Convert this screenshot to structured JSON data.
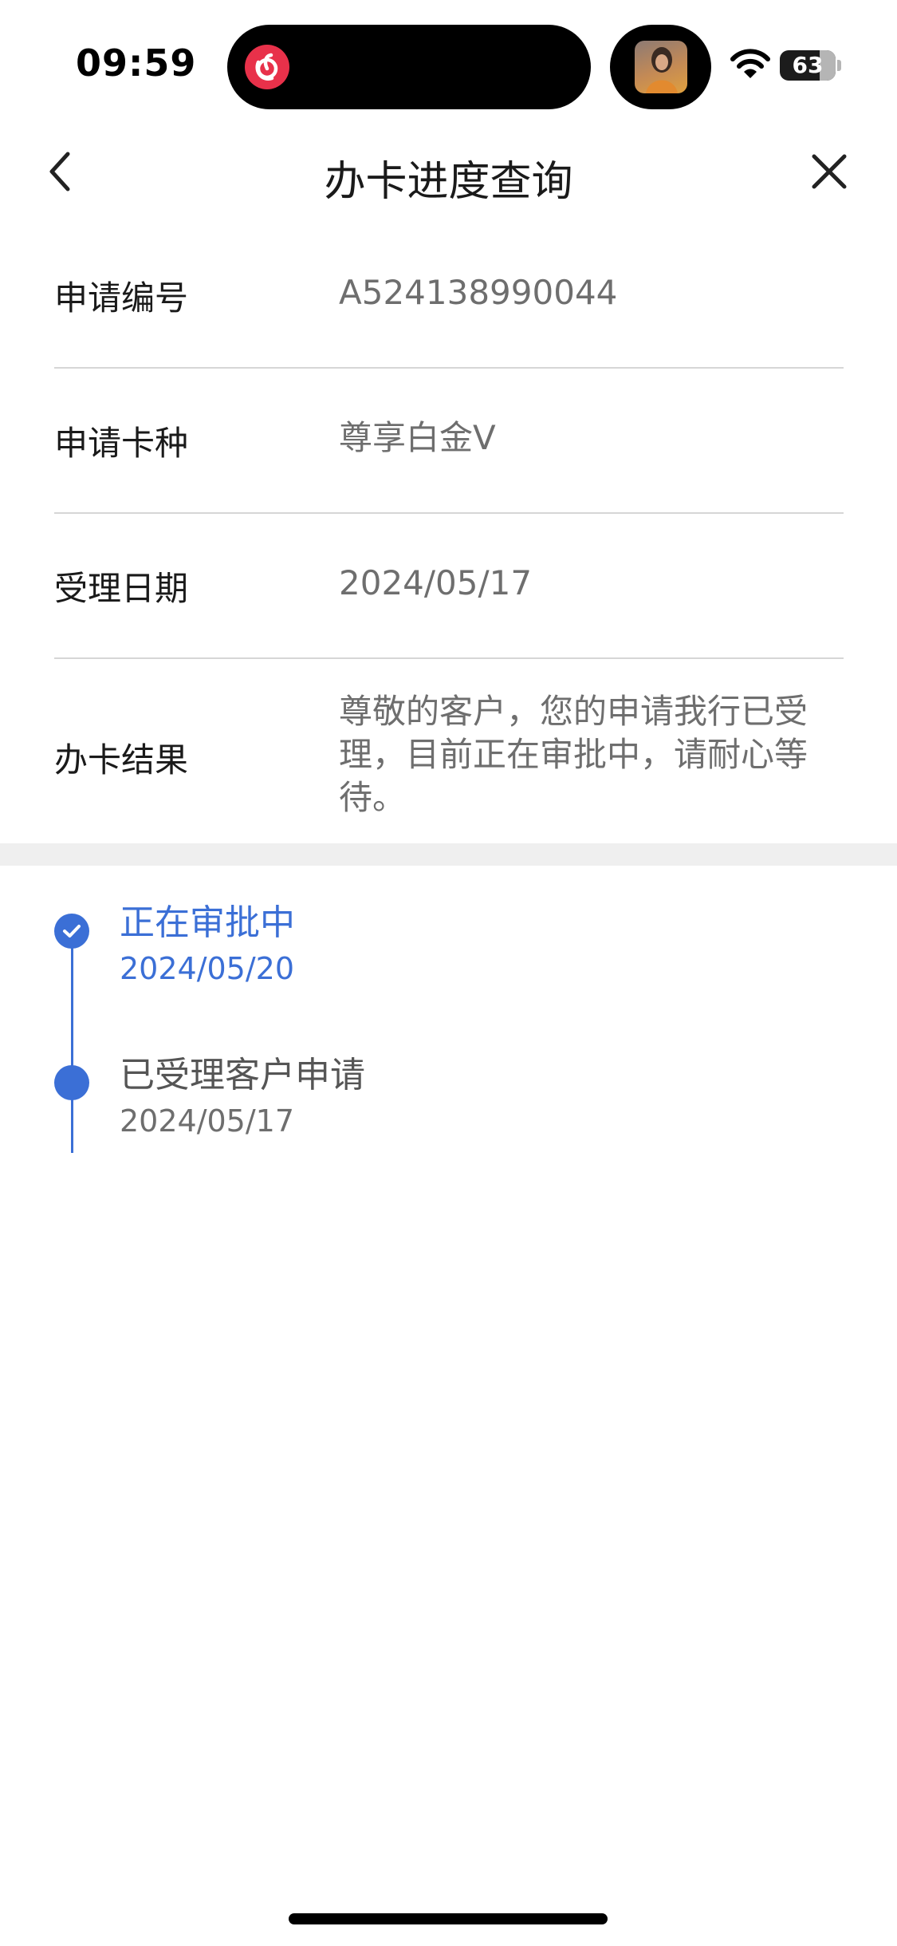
{
  "status_bar": {
    "time": "09:59",
    "battery": "63",
    "icons": [
      "netease-music-icon",
      "album-art",
      "wifi-icon",
      "battery-icon"
    ]
  },
  "nav": {
    "title": "办卡进度查询",
    "back_icon": "chevron-left-icon",
    "close_icon": "close-icon"
  },
  "info": {
    "rows": [
      {
        "label": "申请编号",
        "value": "A524138990044"
      },
      {
        "label": "申请卡种",
        "value": "尊享白金V"
      },
      {
        "label": "受理日期",
        "value": "2024/05/17"
      },
      {
        "label": "办卡结果",
        "value": "尊敬的客户，您的申请我行已受理，目前正在审批中，请耐心等待。"
      }
    ]
  },
  "timeline": {
    "accent_color": "#3b6fd6",
    "steps": [
      {
        "title": "正在审批中",
        "date": "2024/05/20",
        "state": "current"
      },
      {
        "title": "已受理客户申请",
        "date": "2024/05/17",
        "state": "done"
      }
    ]
  }
}
